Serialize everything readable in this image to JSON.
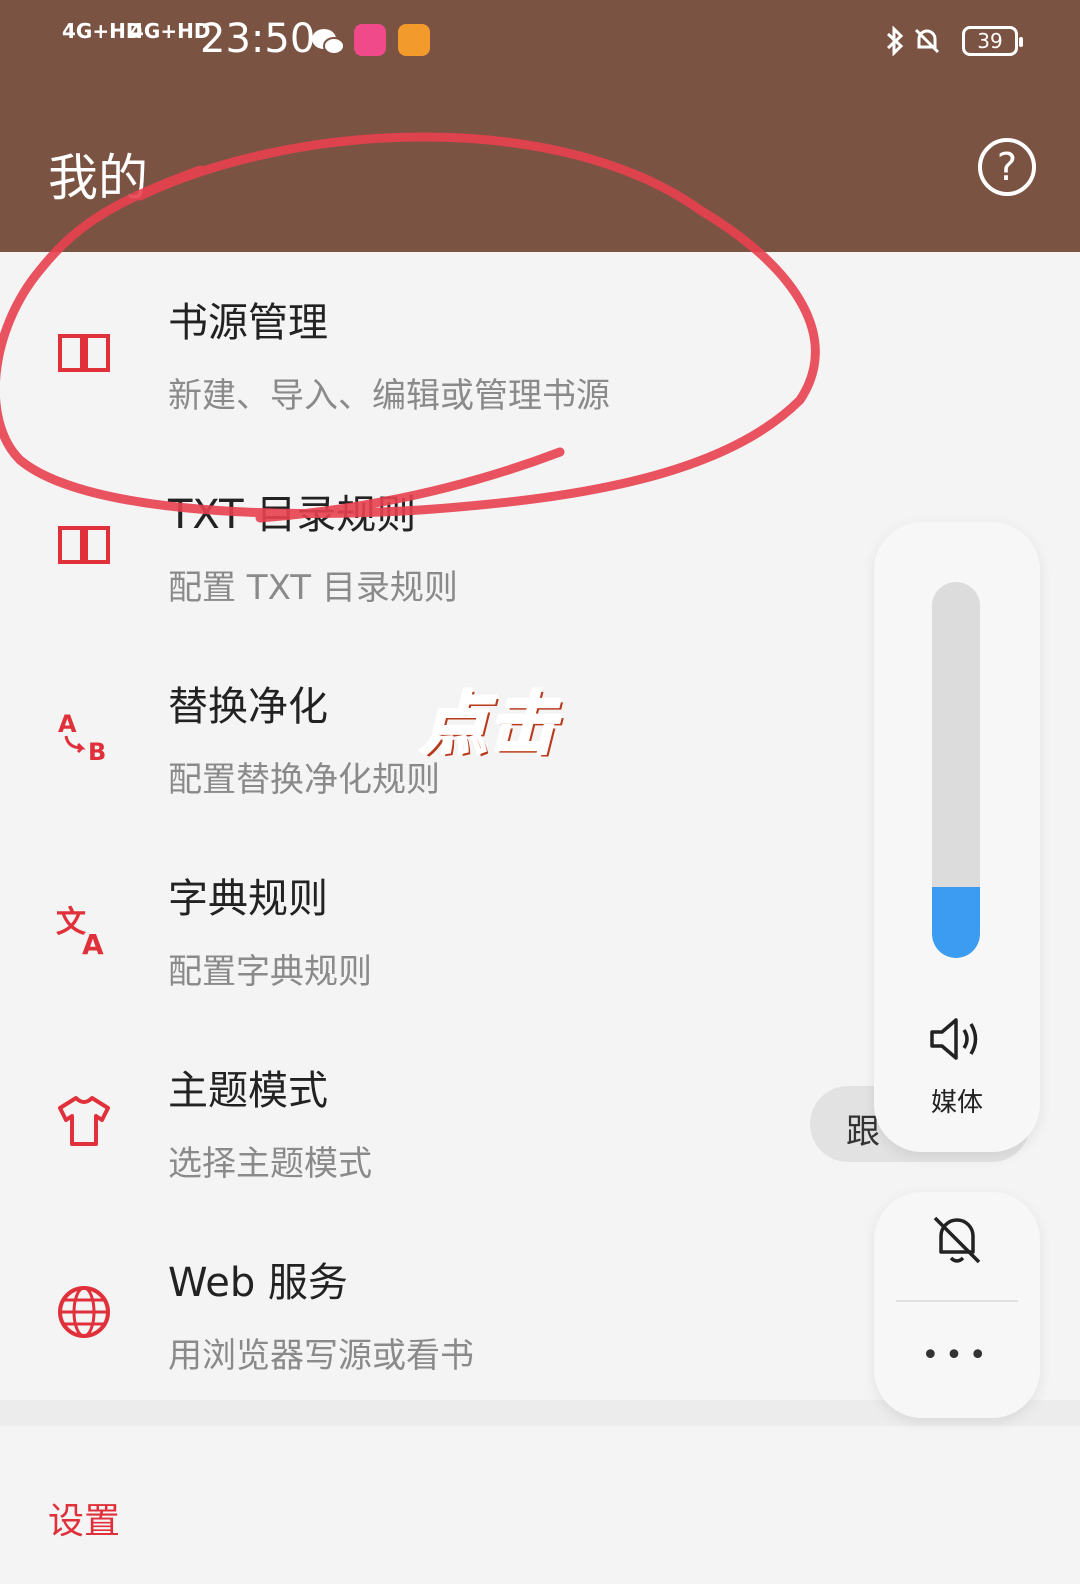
{
  "status_bar": {
    "signal1": "4G+HD",
    "signal2": "4G+HD",
    "time": "23:50",
    "battery": "39"
  },
  "header": {
    "title": "我的",
    "help_icon": "help-circle-icon"
  },
  "menu": [
    {
      "title": "书源管理",
      "subtitle": "新建、导入、编辑或管理书源",
      "icon": "book-open-icon"
    },
    {
      "title": "TXT 目录规则",
      "subtitle": "配置 TXT 目录规则",
      "icon": "book-open-icon"
    },
    {
      "title": "替换净化",
      "subtitle": "配置替换净化规则",
      "icon": "replace-ab-icon"
    },
    {
      "title": "字典规则",
      "subtitle": "配置字典规则",
      "icon": "translate-icon"
    },
    {
      "title": "主题模式",
      "subtitle": "选择主题模式",
      "icon": "tshirt-icon"
    },
    {
      "title": "Web 服务",
      "subtitle": "用浏览器写源或看书",
      "icon": "globe-icon"
    }
  ],
  "settings_label": "设置",
  "overlay": {
    "tap_label": "点击",
    "follow_text": "跟",
    "volume_level": 0.19,
    "media_label": "媒体",
    "more_label": "•••"
  },
  "colors": {
    "appbar": "#7b5343",
    "accent": "#e0303a",
    "volume": "#3b9cf2",
    "annotation": "#e8404f"
  }
}
